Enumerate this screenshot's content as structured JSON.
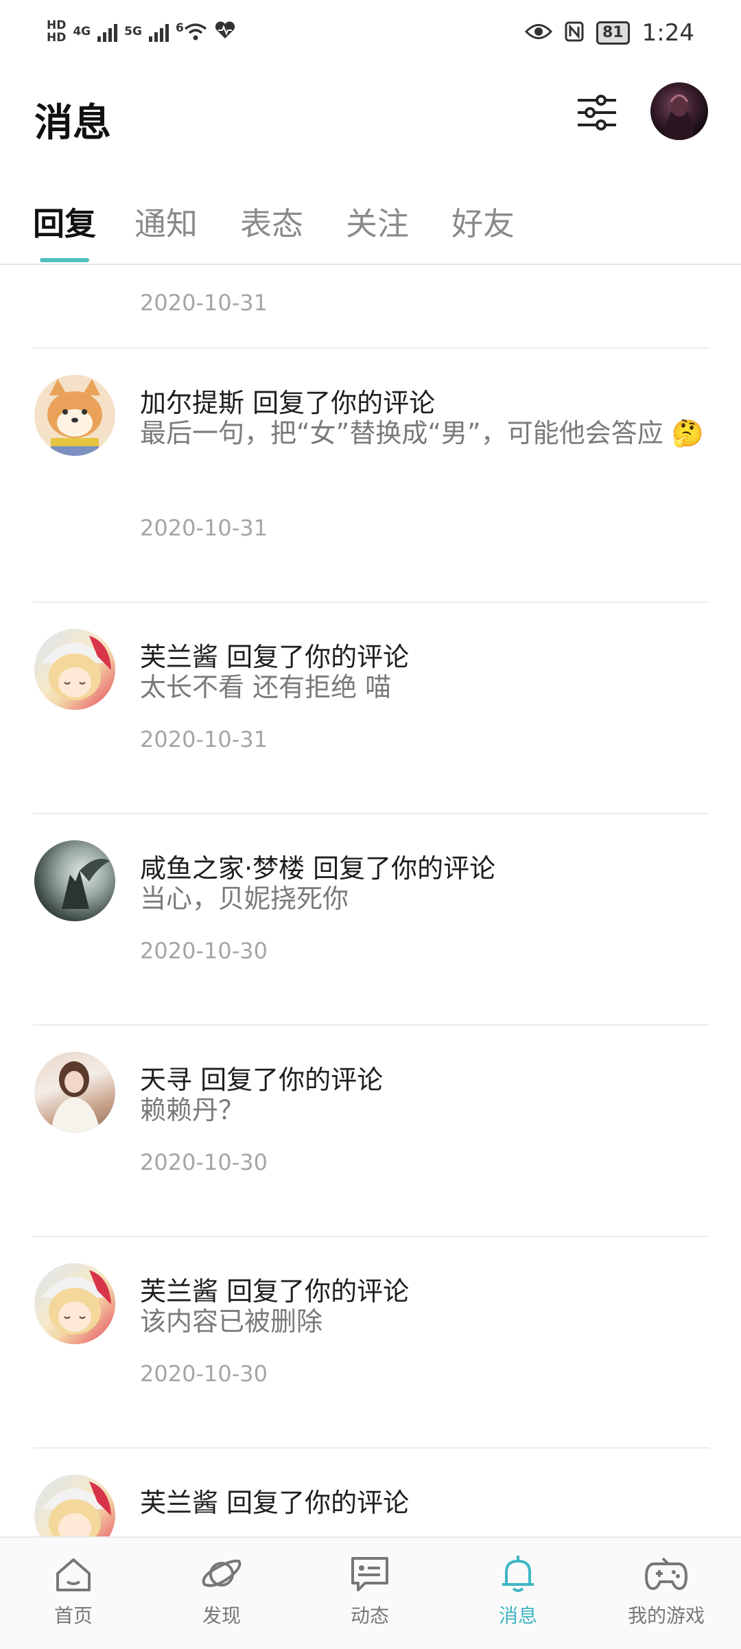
{
  "status_bar": {
    "left_badges": [
      "HD",
      "HD"
    ],
    "network_1": "4G",
    "network_2": "5G",
    "wifi_label": "6",
    "battery": "81",
    "time": "1:24"
  },
  "header": {
    "title": "消息"
  },
  "tabs": [
    {
      "label": "回复",
      "active": true
    },
    {
      "label": "通知",
      "active": false
    },
    {
      "label": "表态",
      "active": false
    },
    {
      "label": "关注",
      "active": false
    },
    {
      "label": "好友",
      "active": false
    }
  ],
  "list": {
    "partial_top_date": "2020-10-31",
    "items": [
      {
        "name": "加尔提斯 回复了你的评论",
        "content": "最后一句，把“女”替换成“男”，可能他会答应 🤔",
        "date": "2020-10-31",
        "avatar": "shiba-dog-avatar"
      },
      {
        "name": "芙兰酱 回复了你的评论",
        "content": "太长不看 还有拒绝 喵",
        "date": "2020-10-31",
        "avatar": "anime-girl-avatar"
      },
      {
        "name": "咸鱼之家·梦楼 回复了你的评论",
        "content": "当心，贝妮挠死你",
        "date": "2020-10-30",
        "avatar": "dark-art-avatar"
      },
      {
        "name": "天寻 回复了你的评论",
        "content": "赖赖丹？",
        "date": "2020-10-30",
        "avatar": "photo-girl-avatar"
      },
      {
        "name": "芙兰酱 回复了你的评论",
        "content": "该内容已被删除",
        "date": "2020-10-30",
        "avatar": "anime-girl-avatar"
      },
      {
        "name": "芙兰酱 回复了你的评论",
        "content": "",
        "date": "",
        "avatar": "anime-girl-avatar"
      }
    ]
  },
  "bottom_nav": [
    {
      "label": "首页",
      "icon": "home-icon",
      "active": false
    },
    {
      "label": "发现",
      "icon": "planet-icon",
      "active": false
    },
    {
      "label": "动态",
      "icon": "chat-card-icon",
      "active": false
    },
    {
      "label": "消息",
      "icon": "bell-icon",
      "active": true
    },
    {
      "label": "我的游戏",
      "icon": "gamepad-icon",
      "active": false
    }
  ],
  "colors": {
    "accent": "#4fbfbf",
    "active_nav": "#3fb6c4",
    "secondary_text": "#7a7a7a",
    "date_text": "#a5a5a5"
  }
}
